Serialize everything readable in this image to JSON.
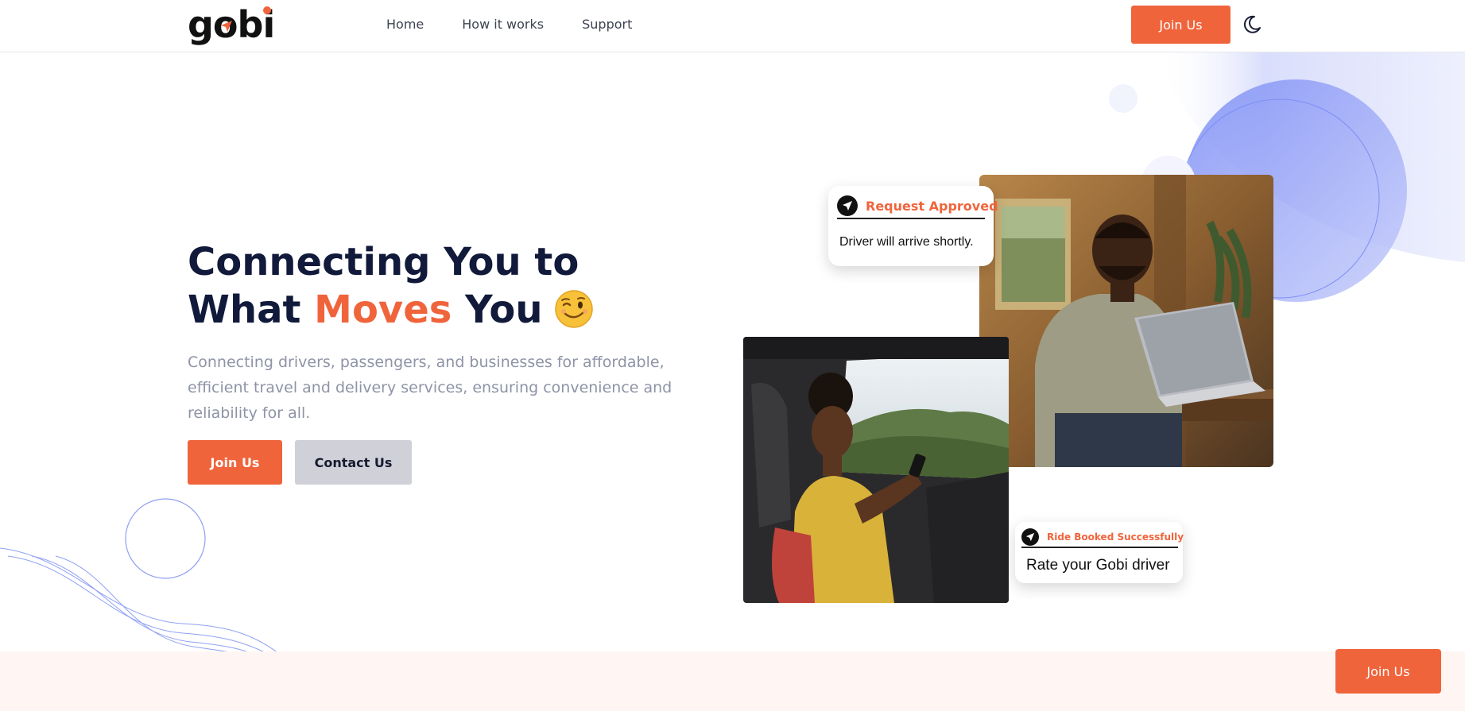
{
  "header": {
    "logo_text": "gobi",
    "nav": [
      {
        "label": "Home"
      },
      {
        "label": "How it works"
      },
      {
        "label": "Support"
      }
    ],
    "join_label": "Join Us",
    "theme_icon": "moon-icon"
  },
  "hero": {
    "title_line1": "Connecting You to",
    "title_line2_pre": "What ",
    "title_line2_accent": "Moves",
    "title_line2_post": " You",
    "emoji_icon": "winking-face-icon",
    "subtitle": "Connecting drivers, passengers, and businesses for affordable, efficient travel and delivery services, ensuring convenience and reliability for all.",
    "join_label": "Join Us",
    "contact_label": "Contact Us"
  },
  "cards": {
    "approved": {
      "title": "Request Approved",
      "body": "Driver will arrive shortly."
    },
    "booked": {
      "title": "Ride Booked Successfully",
      "body": "Rate your Gobi driver"
    }
  },
  "floating": {
    "join_label": "Join Us"
  },
  "colors": {
    "accent": "#f0643c",
    "title": "#111a3a",
    "subtitle": "#8e93a6",
    "secondary_button": "#cfd0d8",
    "decor_blue": "#6f82f0"
  }
}
